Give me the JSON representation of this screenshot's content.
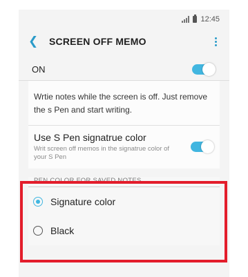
{
  "status_bar": {
    "time": "12:45"
  },
  "appbar": {
    "title": "SCREEN OFF MEMO"
  },
  "master": {
    "label": "ON",
    "enabled": true
  },
  "description": "Wrtie notes while the screen is off. Just remove the s Pen and start writing.",
  "spen_color": {
    "title": "Use S Pen signatrue color",
    "subtitle": "Writ screen off memos in the signatrue color of your S Pen",
    "enabled": true
  },
  "pen_color_section": {
    "header": "PEN COLOR FOR SAVED NOTES",
    "options": [
      {
        "label": "Signature color",
        "selected": true
      },
      {
        "label": "Black",
        "selected": false
      }
    ]
  },
  "colors": {
    "accent": "#41b6e0",
    "highlight": "#e31d2b"
  }
}
